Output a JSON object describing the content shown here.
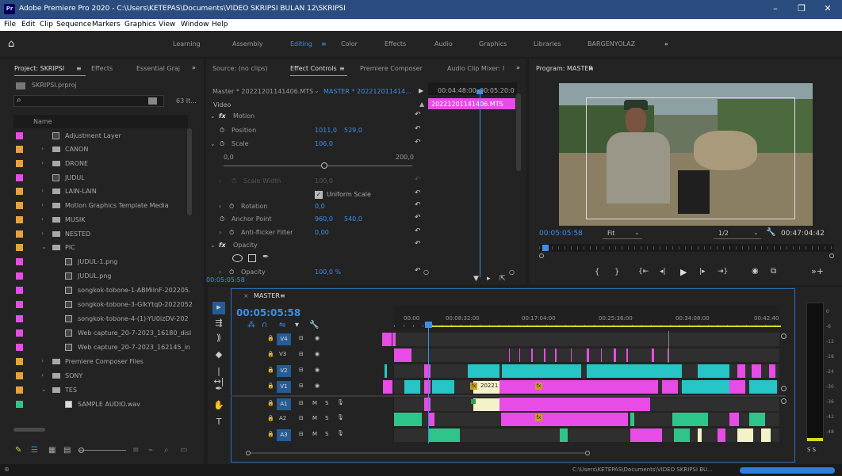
{
  "title_bar": {
    "app_icon": "Pr",
    "title": "Adobe Premiere Pro 2020 - C:\\Users\\KETEPAS\\Documents\\VIDEO SKRIPSI BULAN 12\\SKRIPSI"
  },
  "menu": [
    "File",
    "Edit",
    "Clip",
    "Sequence",
    "Markers",
    "Graphics",
    "View",
    "Window",
    "Help"
  ],
  "workspaces": {
    "items": [
      "Learning",
      "Assembly",
      "Editing",
      "Color",
      "Effects",
      "Audio",
      "Graphics",
      "Libraries",
      "BARGENYOLAZ"
    ],
    "active": "Editing",
    "menu_glyph": "≡",
    "more": "»"
  },
  "project": {
    "tab_label": "Project: SKRIPSI",
    "tab_menu": "≡",
    "tabs": [
      "Effects",
      "Essential Graj"
    ],
    "more": "»",
    "file": "SKRIPSI.prproj",
    "count": "63 It...",
    "col_name": "Name",
    "items": [
      {
        "name": "Adjustment Layer",
        "type": "file",
        "color": "#e84ce6"
      },
      {
        "name": "CANON",
        "type": "folder",
        "color": "#e8a23c"
      },
      {
        "name": "DRONE",
        "type": "folder",
        "color": "#e8a23c"
      },
      {
        "name": "JUDUL",
        "type": "file",
        "color": "#e84ce6"
      },
      {
        "name": "LAIN-LAIN",
        "type": "folder",
        "color": "#e8a23c"
      },
      {
        "name": "Motion Graphics Template Media",
        "type": "folder",
        "color": "#e8a23c"
      },
      {
        "name": "MUSIK",
        "type": "folder",
        "color": "#e8a23c"
      },
      {
        "name": "NESTED",
        "type": "folder",
        "color": "#e8a23c"
      },
      {
        "name": "PIC",
        "type": "folder",
        "color": "#e8a23c"
      },
      {
        "name": "JUDUL-1.png",
        "type": "file",
        "color": "#e84ce6"
      },
      {
        "name": "JUDUL.png",
        "type": "file",
        "color": "#e84ce6"
      },
      {
        "name": "songkok-tobone-1-ABMilnF-202205.",
        "type": "file",
        "color": "#e84ce6"
      },
      {
        "name": "songkok-tobone-3-GlkYtq0-2022052",
        "type": "file",
        "color": "#e84ce6"
      },
      {
        "name": "songkok-tobone-4-(1)-YU0izDV-202",
        "type": "file",
        "color": "#e84ce6"
      },
      {
        "name": "Web capture_20-7-2023_16180_disl",
        "type": "file",
        "color": "#e84ce6"
      },
      {
        "name": "Web capture_20-7-2023_162145_in",
        "type": "file",
        "color": "#e84ce6"
      },
      {
        "name": "Premiere Composer Files",
        "type": "folder",
        "color": "#e8a23c"
      },
      {
        "name": "SONY",
        "type": "folder",
        "color": "#e8a23c"
      },
      {
        "name": "TES",
        "type": "folder",
        "color": "#e8a23c"
      },
      {
        "name": "SAMPLE AUDIO.wav",
        "type": "audio",
        "color": "#2ec58a"
      }
    ]
  },
  "effect_controls": {
    "tabs": [
      "Source: (no clips)",
      "Effect Controls",
      "Premiere Composer",
      "Audio Clip Mixer: I"
    ],
    "tab_menu": "≡",
    "more": "»",
    "master_label": "Master * 20221201141406.MTS",
    "seq_label": "MASTER * 202212011414...",
    "mini_time1": "00:04:48:00",
    "mini_time2": "00:05:20:0",
    "clip_name": "20221201141406.MTS",
    "section": "Video",
    "motion": "Motion",
    "position_label": "Position",
    "position_x": "1011,0",
    "position_y": "529,0",
    "scale_label": "Scale",
    "scale_val": "106,0",
    "slider_min": "0,0",
    "slider_max": "200,0",
    "scale_width_label": "Scale Width",
    "scale_width_val": "100,0",
    "uniform": "Uniform Scale",
    "rotation_label": "Rotation",
    "rotation_val": "0,0",
    "anchor_label": "Anchor Point",
    "anchor_x": "960,0",
    "anchor_y": "540,0",
    "flicker_label": "Anti-flicker Filter",
    "flicker_val": "0,00",
    "opacity": "Opacity",
    "opacity_label": "Opacity",
    "opacity_val": "100,0 %",
    "time": "00:05:05:58"
  },
  "program": {
    "tab_label": "Program: MASTER",
    "tab_menu": "≡",
    "timecode": "00:05:05:58",
    "fit": "Fit",
    "res": "1/2",
    "duration": "00:47:04:42"
  },
  "timeline": {
    "seq_name": "MASTER",
    "tab_menu": "≡",
    "timecode": "00:05:05:58",
    "ruler": [
      "00:00",
      "00:08:32:00",
      "00:17:04:00",
      "00:25:36:00",
      "00:34:08:00",
      "00:42:40"
    ],
    "video_tracks": [
      "V4",
      "V3",
      "V2",
      "V1"
    ],
    "audio_tracks": [
      "A1",
      "A2",
      "A3"
    ],
    "clip_label": "20221",
    "clip_fx": "fx",
    "colors": {
      "video": "#e84ce6",
      "cyan": "#27c5c5",
      "audio": "#2ec58a",
      "track_sel": "#265c94"
    }
  },
  "meter": {
    "labels": [
      "0",
      "-6",
      "-12",
      "-18",
      "-24",
      "-30",
      "-36",
      "-42",
      "-48"
    ],
    "solo": "S S"
  },
  "status": {
    "path": "C:\\Users\\KETEPAS\\Documents\\VIDEO SKRIPSI BU..."
  }
}
